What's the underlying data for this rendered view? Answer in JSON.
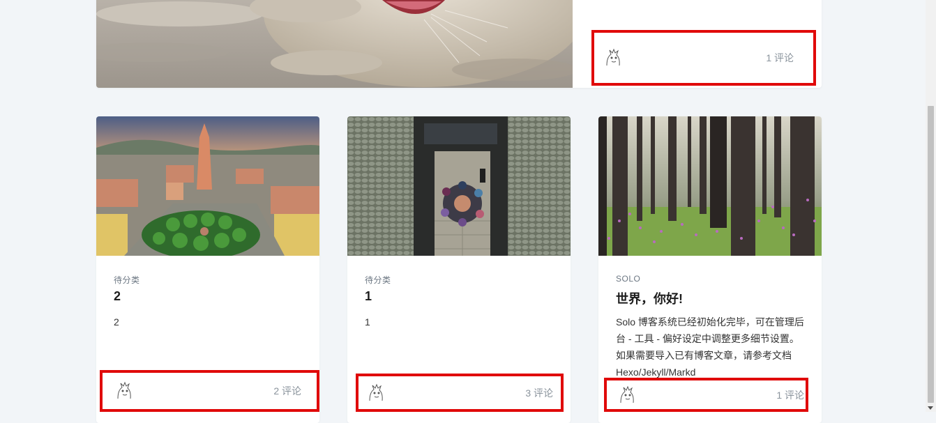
{
  "featured": {
    "comments_label": "1 评论"
  },
  "cards": [
    {
      "category": "待分类",
      "title": "2",
      "summary": "2",
      "comments_label": "2 评论"
    },
    {
      "category": "待分类",
      "title": "1",
      "summary": "1",
      "comments_label": "3 评论"
    },
    {
      "category": "SOLO",
      "title": "世界，你好!",
      "summary": "Solo 博客系统已经初始化完毕，可在管理后台 - 工具 - 偏好设定中调整更多细节设置。如果需要导入已有博客文章，请参考文档 Hexo/Jekyll/Markd",
      "comments_label": "1 评论"
    }
  ],
  "colors": {
    "highlight_border": "#e00a0a",
    "page_background": "#f2f5f8",
    "comment_text": "#8a939c"
  },
  "icons": {
    "avatar": "anime-character-avatar-icon"
  }
}
